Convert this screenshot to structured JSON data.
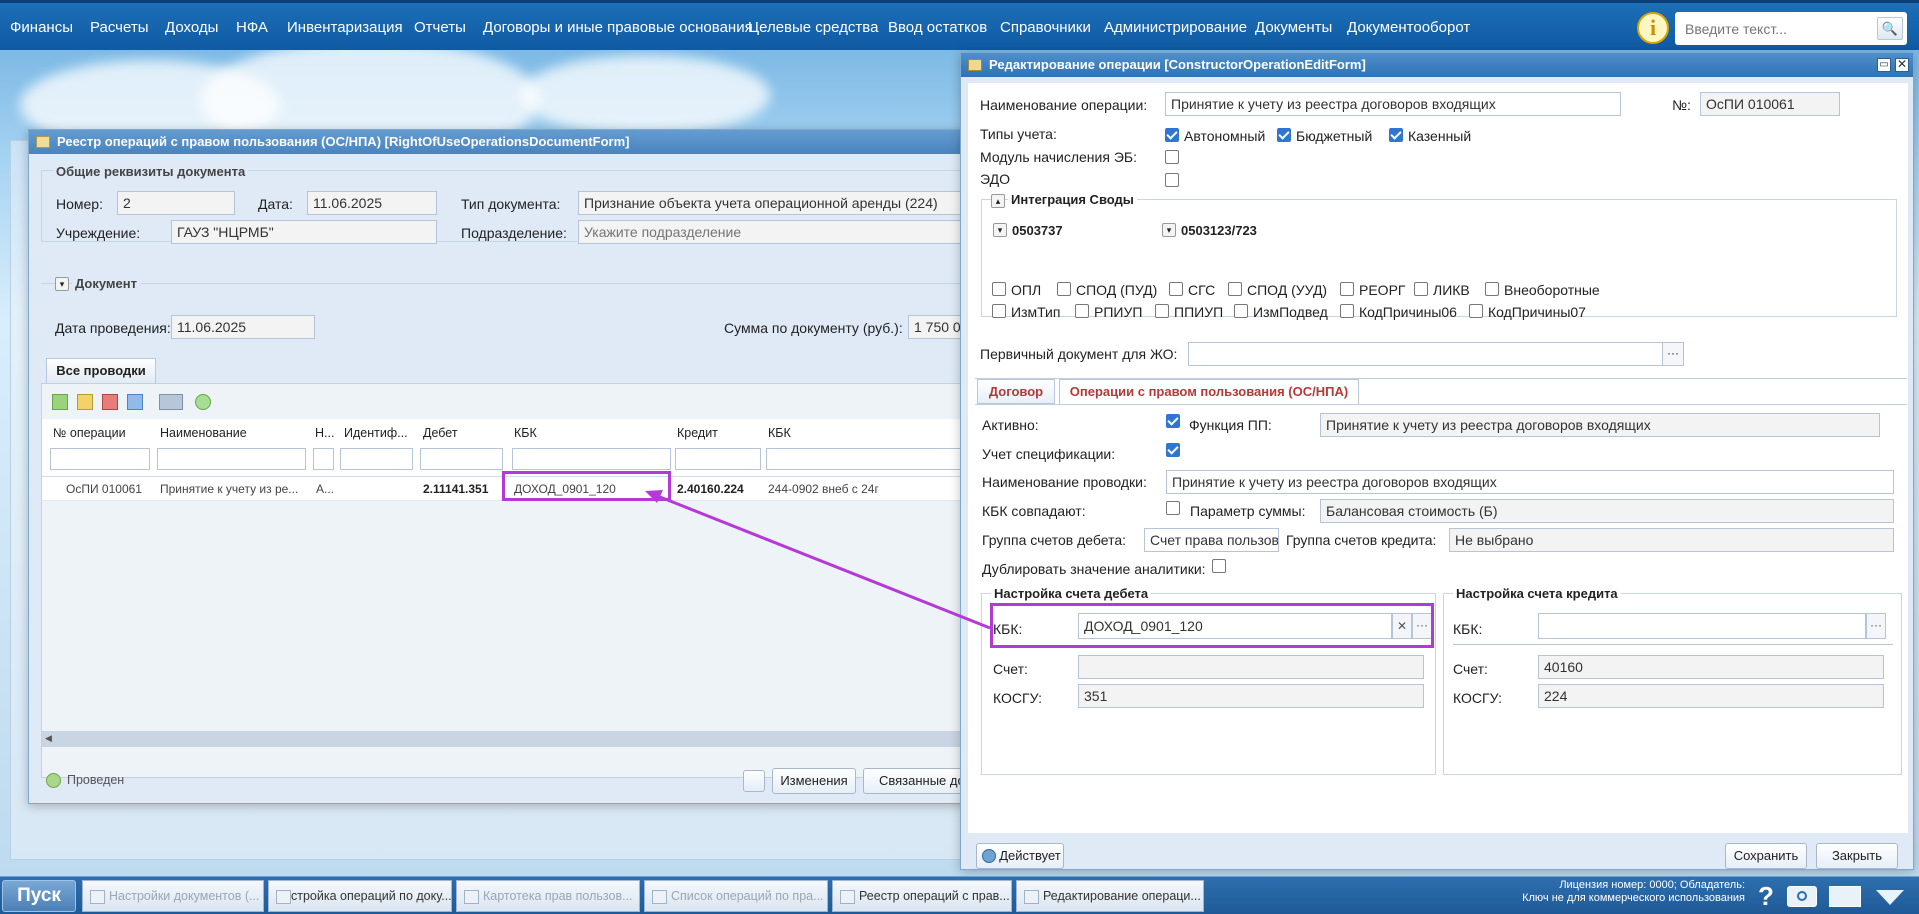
{
  "menu": [
    "Финансы",
    "Расчеты",
    "Доходы",
    "НФА",
    "Инвентаризация",
    "Отчеты",
    "Договоры и иные правовые основания",
    "Целевые средства",
    "Ввод остатков",
    "Справочники",
    "Администрирование",
    "Документы",
    "Документооборот"
  ],
  "search": {
    "placeholder": "Введите текст..."
  },
  "registry": {
    "title": "Реестр операций с правом пользования (ОС/НПА) [RightOfUseOperationsDocumentForm]",
    "general_title": "Общие реквизиты документа",
    "number_label": "Номер:",
    "number_value": "2",
    "date_label": "Дата:",
    "date_value": "11.06.2025",
    "doc_type_label": "Тип документа:",
    "doc_type_value": "Признание объекта учета операционной аренды (224)",
    "institution_label": "Учреждение:",
    "institution_value": "ГАУЗ \"НЦРМБ\"",
    "subdivision_label": "Подразделение:",
    "subdivision_placeholder": "Укажите подразделение",
    "document_title": "Документ",
    "posting_date_label": "Дата проведения:",
    "posting_date_value": "11.06.2025",
    "sum_label": "Сумма по документу (руб.):",
    "sum_value": "1 750 0",
    "tab_all": "Все проводки",
    "columns": [
      "№ операции",
      "Наименование",
      "Н...",
      "Идентиф...",
      "Дебет",
      "КБК",
      "Кредит",
      "КБК"
    ],
    "row": [
      "ОсПИ 010061",
      "Принятие к учету из ре...",
      "А...",
      "",
      "2.11141.351",
      "ДОХОД_0901_120",
      "2.40160.224",
      "244-0902 внеб с 24г"
    ],
    "status": "Проведен",
    "btn_changes": "Изменения",
    "btn_related": "Связанные доку"
  },
  "editor": {
    "title": "Редактирование операции [ConstructorOperationEditForm]",
    "name_label": "Наименование операции:",
    "name_value": "Принятие к учету из реестра договоров входящих",
    "no_label": "№:",
    "no_value": "ОсПИ 010061",
    "types_label": "Типы учета:",
    "type1": "Автономный",
    "type2": "Бюджетный",
    "type3": "Казенный",
    "eb_label": "Модуль начисления ЭБ:",
    "edo_label": "ЭДО",
    "integration_title": "Интеграция Своды",
    "form1": "0503737",
    "form2": "0503123/723",
    "chk_row1": [
      "ОПЛ",
      "СПОД (ПУД)",
      "СГС",
      "СПОД (УУД)",
      "РЕОРГ",
      "ЛИКВ",
      "Внеоборотные"
    ],
    "chk_row2": [
      "ИзмТип",
      "РПИУП",
      "ППИУП",
      "ИзмПодвед",
      "КодПричины06",
      "КодПричины07"
    ],
    "primary_doc_label": "Первичный документ для ЖО:",
    "tab1": "Договор",
    "tab2": "Операции с правом пользования (ОС/НПА)",
    "active_label": "Активно:",
    "func_pp_label": "Функция ПП:",
    "func_pp_value": "Принятие к учету из реестра договоров входящих",
    "spec_label": "Учет спецификации:",
    "entry_name_label": "Наименование проводки:",
    "entry_name_value": "Принятие к учету из реестра договоров входящих",
    "kbk_match_label": "КБК совпадают:",
    "sum_param_label": "Параметр суммы:",
    "sum_param_value": "Балансовая стоимость (Б)",
    "debit_group_label": "Группа счетов дебета:",
    "debit_group_value": "Счет права пользова",
    "credit_group_label": "Группа счетов кредита:",
    "credit_group_value": "Не выбрано",
    "dup_label": "Дублировать значение аналитики:",
    "debit_title": "Настройка счета дебета",
    "credit_title": "Настройка счета кредита",
    "kbk_label": "КБК:",
    "debit_kbk": "ДОХОД_0901_120",
    "account_label": "Счет:",
    "kosgu_label": "КОСГУ:",
    "debit_kosgu": "351",
    "credit_account": "40160",
    "credit_kosgu": "224",
    "status_btn": "Действует",
    "save_btn": "Сохранить",
    "close_btn": "Закрыть"
  },
  "taskbar": {
    "start": "Пуск",
    "tasks": [
      "Настройки документов (...",
      "Настройка операций по доку...",
      "Картотека прав пользов...",
      "Список операций по пра...",
      "Реестр операций с прав...",
      "Редактирование операци..."
    ],
    "license": "Лицензия номер: 0000; Обладатель:",
    "license2": "Ключ не для коммерческого использования"
  },
  "colors": {
    "accent": "#2f72b4",
    "highlight": "#b43ad6"
  }
}
